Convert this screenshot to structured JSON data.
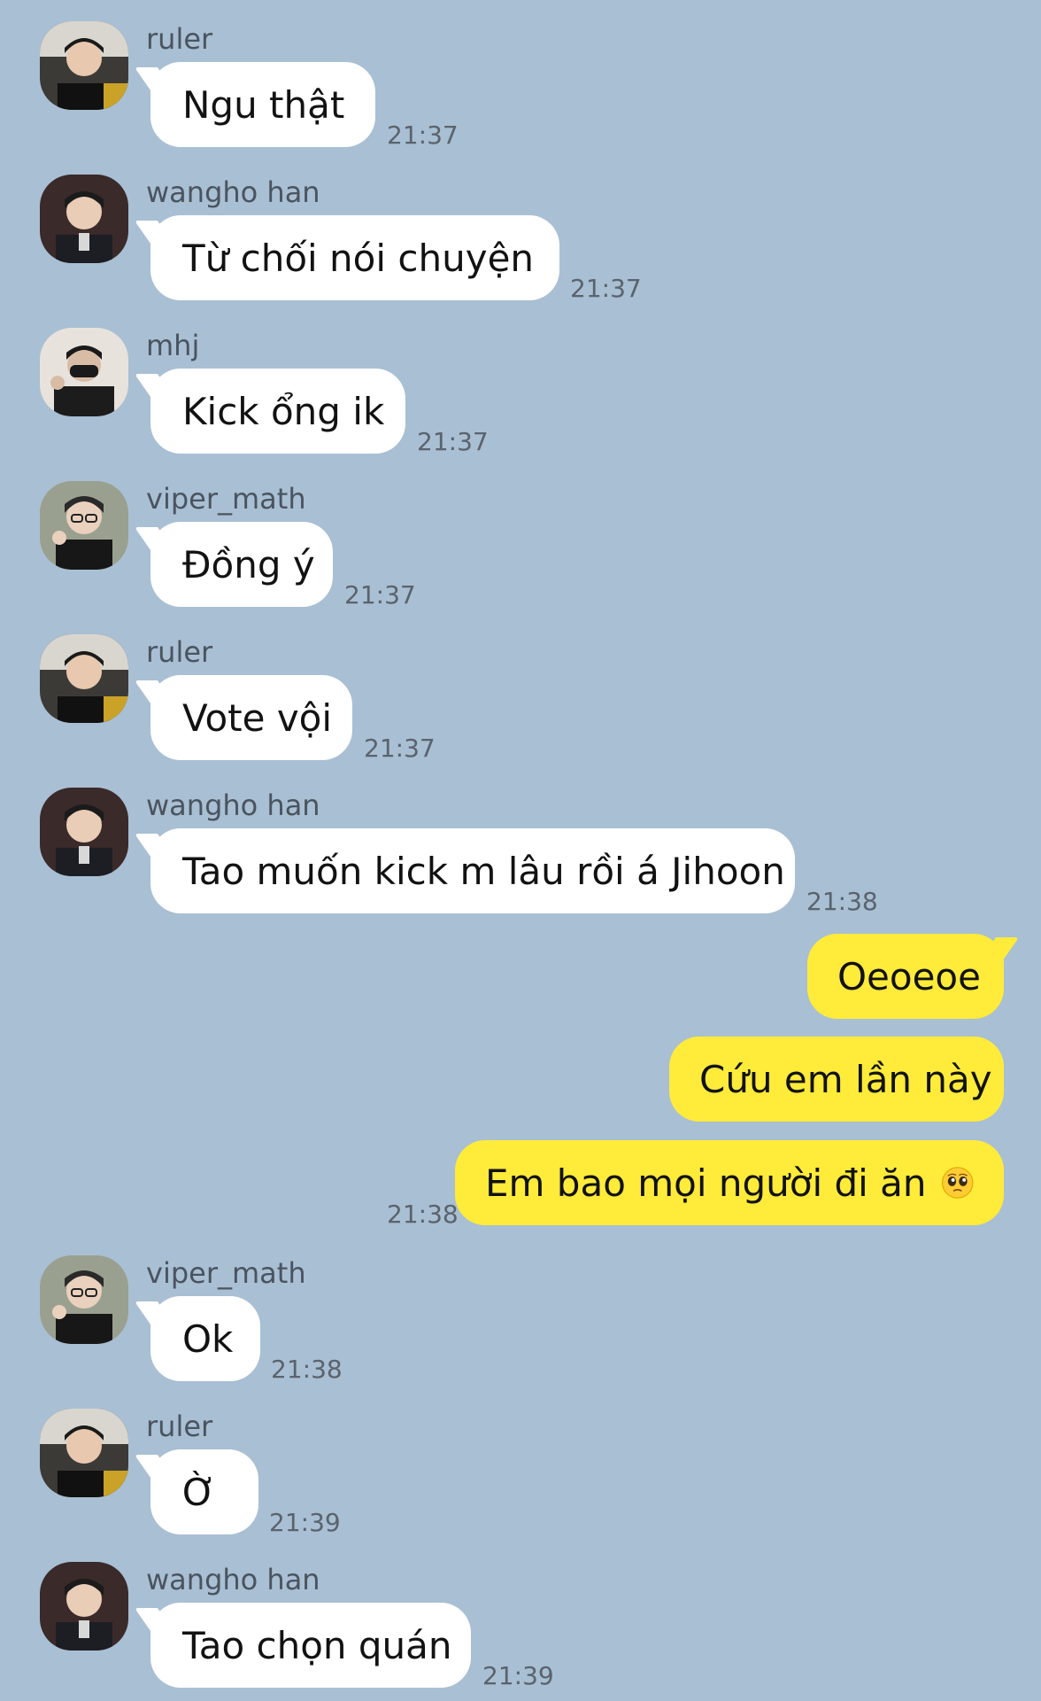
{
  "messages": [
    {
      "sender": "ruler",
      "text": "Ngu thật",
      "time": "21:37",
      "avatar": "ruler-avatar"
    },
    {
      "sender": "wangho han",
      "text": "Từ chối nói chuyện",
      "time": "21:37",
      "avatar": "wangho-han-avatar"
    },
    {
      "sender": "mhj",
      "text": "Kick ổng ik",
      "time": "21:37",
      "avatar": "mhj-avatar"
    },
    {
      "sender": "viper_math",
      "text": "Đồng ý",
      "time": "21:37",
      "avatar": "viper-math-avatar"
    },
    {
      "sender": "ruler",
      "text": "Vote vội",
      "time": "21:37",
      "avatar": "ruler-avatar"
    },
    {
      "sender": "wangho han",
      "text": "Tao muốn kick m lâu rồi á Jihoon",
      "time": "21:38",
      "avatar": "wangho-han-avatar"
    },
    {
      "sender": "me",
      "text": "Oeoeoe",
      "time": ""
    },
    {
      "sender": "me",
      "text": "Cứu em lần này",
      "time": ""
    },
    {
      "sender": "me",
      "text": "Em bao mọi người đi ăn",
      "time": "21:38",
      "emoji": "pleading-face-emoji"
    },
    {
      "sender": "viper_math",
      "text": "Ok",
      "time": "21:38",
      "avatar": "viper-math-avatar"
    },
    {
      "sender": "ruler",
      "text": "Ờ",
      "time": "21:39",
      "avatar": "ruler-avatar"
    },
    {
      "sender": "wangho han",
      "text": "Tao chọn quán",
      "time": "21:39",
      "avatar": "wangho-han-avatar"
    }
  ],
  "colors": {
    "background": "#a9bfd3",
    "incoming_bubble": "#ffffff",
    "outgoing_bubble": "#ffeb3a"
  }
}
